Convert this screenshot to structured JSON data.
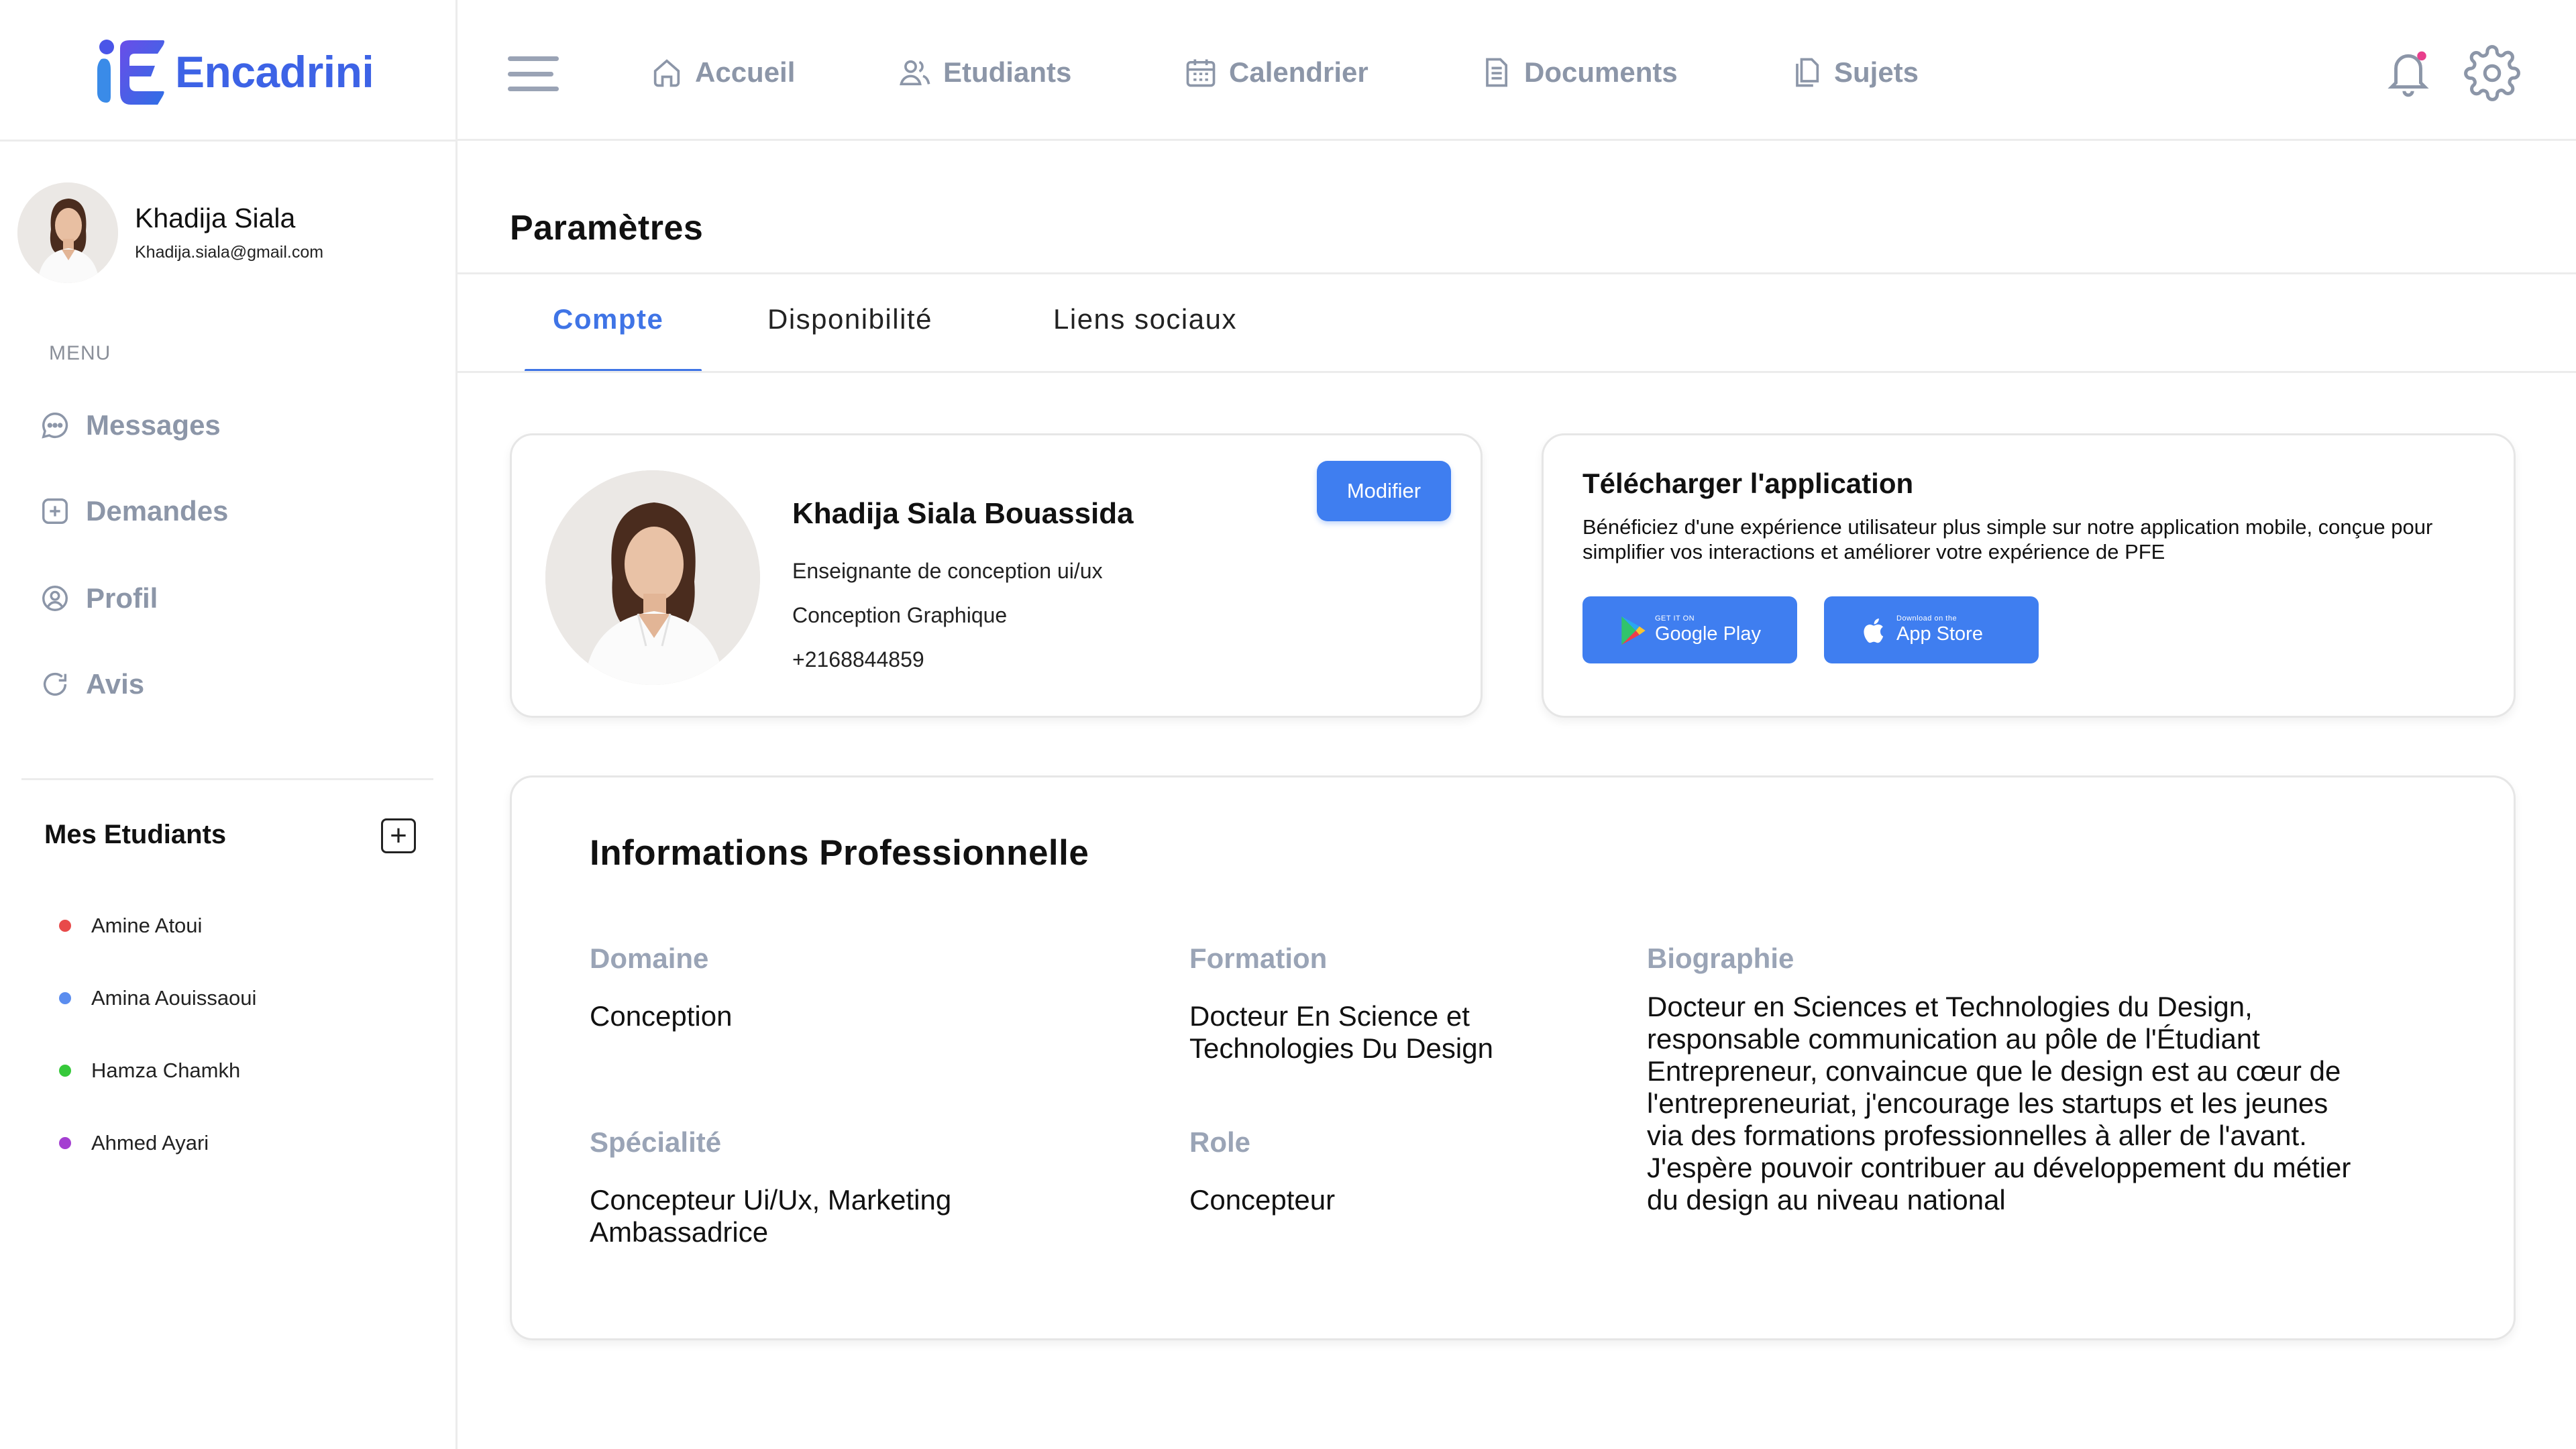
{
  "app": {
    "logo_text": "Encadrini",
    "brand_color": "#3d63e6",
    "accent": "#3f7ef0"
  },
  "user": {
    "name": "Khadija Siala",
    "email": "Khadija.siala@gmail.com"
  },
  "sidebar": {
    "menu_label": "MENU",
    "items": [
      {
        "label": "Messages",
        "icon": "chat-icon"
      },
      {
        "label": "Demandes",
        "icon": "plus-square-icon"
      },
      {
        "label": "Profil",
        "icon": "user-circle-icon"
      },
      {
        "label": "Avis",
        "icon": "refresh-icon"
      }
    ],
    "students_title": "Mes Etudiants",
    "add_symbol": "+",
    "students": [
      {
        "name": "Amine Atoui",
        "color": "#e84a4a"
      },
      {
        "name": "Amina Aouissaoui",
        "color": "#5b8def"
      },
      {
        "name": "Hamza Chamkh",
        "color": "#36c93a"
      },
      {
        "name": "Ahmed Ayari",
        "color": "#a43fd1"
      }
    ]
  },
  "nav": {
    "items": [
      {
        "label": "Accueil",
        "icon": "home-icon"
      },
      {
        "label": "Etudiants",
        "icon": "users-icon"
      },
      {
        "label": "Calendrier",
        "icon": "calendar-icon"
      },
      {
        "label": "Documents",
        "icon": "document-icon"
      },
      {
        "label": "Sujets",
        "icon": "copy-icon"
      }
    ],
    "notification_dot_color": "#e83e8c"
  },
  "page": {
    "title": "Paramètres",
    "tabs": [
      {
        "label": "Compte",
        "active": true
      },
      {
        "label": "Disponibilité",
        "active": false
      },
      {
        "label": "Liens sociaux",
        "active": false
      }
    ]
  },
  "profile_card": {
    "name": "Khadija Siala Bouassida",
    "role": "Enseignante de conception ui/ux",
    "field": "Conception Graphique",
    "phone": "+2168844859",
    "modify_label": "Modifier"
  },
  "app_card": {
    "title": "Télécharger l'application",
    "description": "Bénéficiez d'une expérience utilisateur plus simple sur notre application mobile, conçue pour simplifier vos interactions et améliorer  votre expérience de PFE",
    "google_small": "GET IT ON",
    "google_big": "Google Play",
    "apple_small": "Download on the",
    "apple_big": "App Store"
  },
  "professional": {
    "title": "Informations Professionnelle",
    "domaine_label": "Domaine",
    "domaine_value": "Conception",
    "formation_label": "Formation",
    "formation_value": "Docteur En Science et Technologies Du Design",
    "biographie_label": "Biographie",
    "biographie_value": "Docteur en Sciences et Technologies du Design, responsable communication au pôle de l'Étudiant Entrepreneur, convaincue que le design est au cœur de l'entrepreneuriat, j'encourage les startups et les jeunes via des formations professionnelles à aller de l'avant. J'espère pouvoir contribuer au développement du métier du design au niveau national",
    "specialite_label": "Spécialité",
    "specialite_value": "Concepteur Ui/Ux, Marketing Ambassadrice",
    "role_label": "Role",
    "role_value": "Concepteur"
  }
}
